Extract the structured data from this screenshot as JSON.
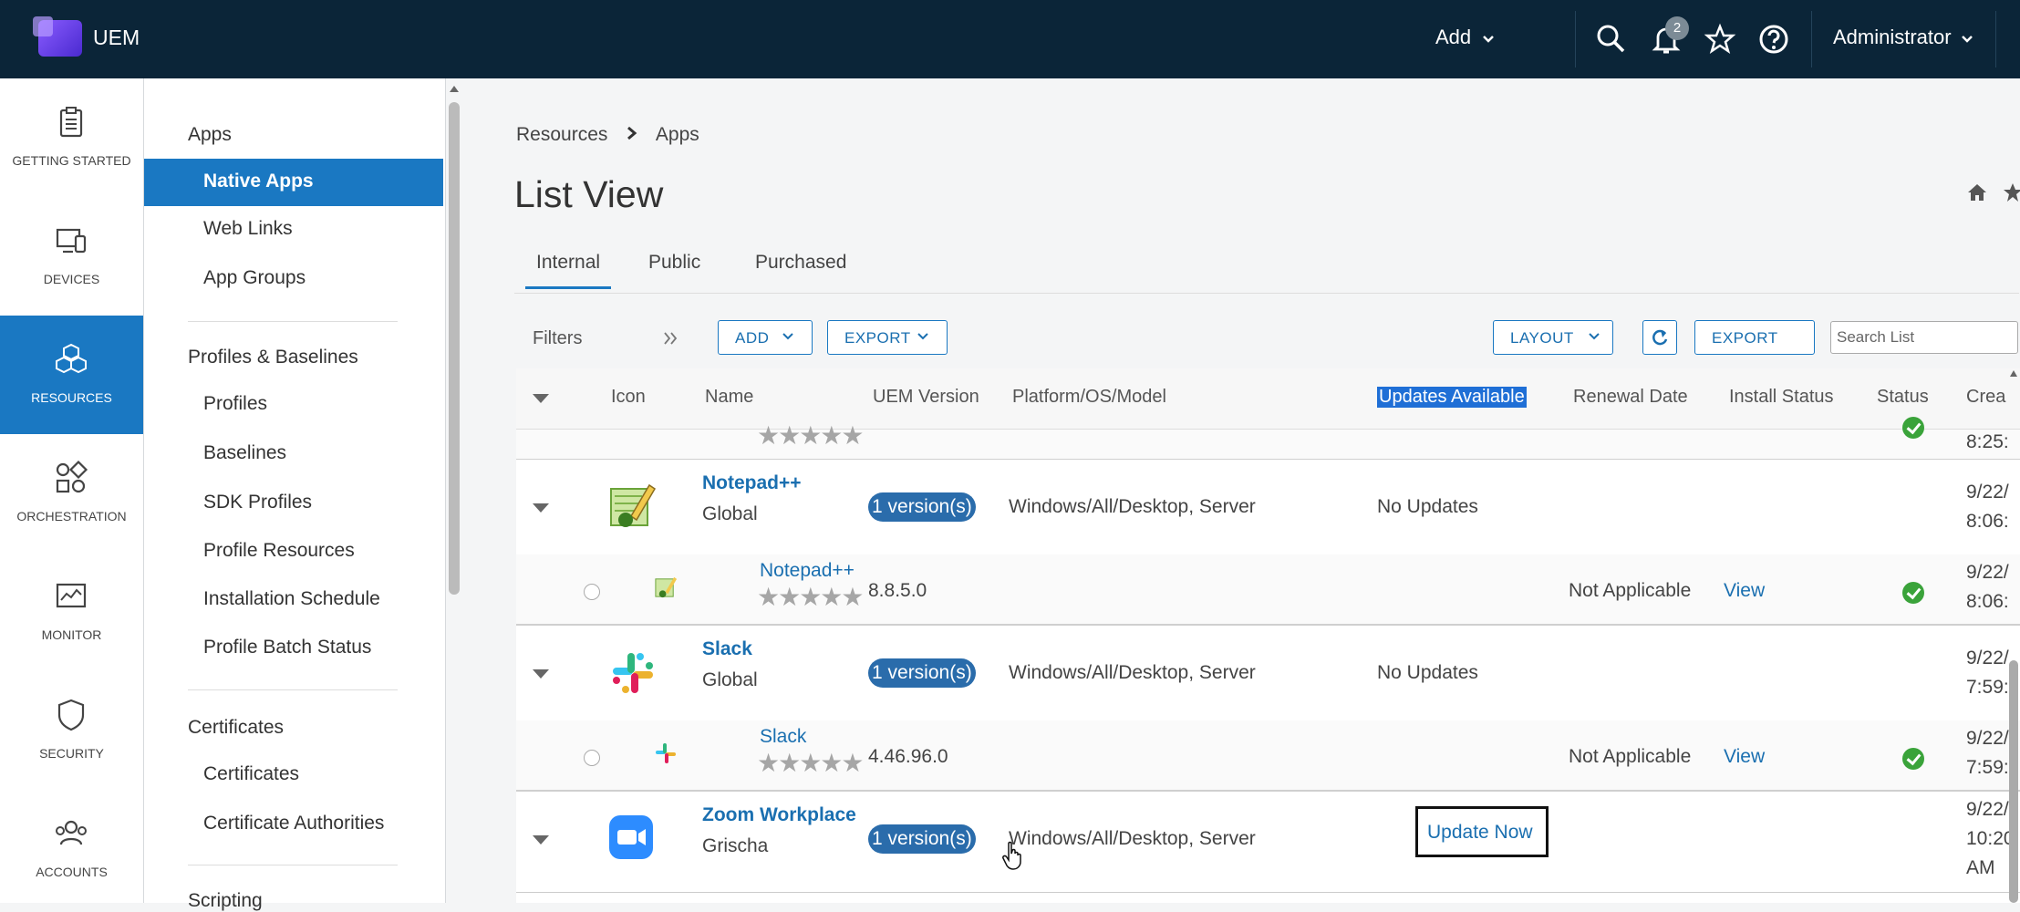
{
  "header": {
    "app_name": "UEM",
    "add_label": "Add",
    "notification_count": "2",
    "user_label": "Administrator"
  },
  "left_nav": [
    {
      "label": "GETTING STARTED",
      "icon": "clipboard-icon"
    },
    {
      "label": "DEVICES",
      "icon": "devices-icon"
    },
    {
      "label": "RESOURCES",
      "icon": "cubes-icon",
      "active": true
    },
    {
      "label": "ORCHESTRATION",
      "icon": "orchestration-icon"
    },
    {
      "label": "MONITOR",
      "icon": "monitor-icon"
    },
    {
      "label": "SECURITY",
      "icon": "shield-icon"
    },
    {
      "label": "ACCOUNTS",
      "icon": "accounts-icon"
    }
  ],
  "sub_nav": {
    "sections": [
      {
        "title": "Apps",
        "items": [
          "Native Apps",
          "Web Links",
          "App Groups"
        ]
      },
      {
        "title": "Profiles & Baselines",
        "items": [
          "Profiles",
          "Baselines",
          "SDK Profiles",
          "Profile Resources",
          "Installation Schedule",
          "Profile Batch Status"
        ]
      },
      {
        "title": "Certificates",
        "items": [
          "Certificates",
          "Certificate Authorities"
        ]
      },
      {
        "title": "Scripting",
        "items": []
      }
    ],
    "active_item": "Native Apps"
  },
  "breadcrumb": {
    "root": "Resources",
    "current": "Apps"
  },
  "page_title": "List View",
  "tabs": [
    {
      "label": "Internal",
      "active": true
    },
    {
      "label": "Public"
    },
    {
      "label": "Purchased"
    }
  ],
  "toolbar": {
    "filters_label": "Filters",
    "add_label": "ADD",
    "export_label": "EXPORT",
    "layout_label": "LAYOUT",
    "export2_label": "EXPORT",
    "search_placeholder": "Search List"
  },
  "columns": [
    "Icon",
    "Name",
    "UEM Version",
    "Platform/OS/Model",
    "Updates Available",
    "Renewal Date",
    "Install Status",
    "Status",
    "Crea"
  ],
  "highlighted_column": "Updates Available",
  "partial_row": {
    "created": "8:25:"
  },
  "rows": [
    {
      "app": {
        "name": "Notepad++",
        "org": "Global",
        "versions": "1 version(s)",
        "platform": "Windows/All/Desktop, Server",
        "updates": "No Updates",
        "created_date": "9/22/",
        "created_time": "8:06:"
      },
      "version": {
        "name": "Notepad++",
        "version": "8.8.5.0",
        "install_status": "Not Applicable",
        "view": "View",
        "created_date": "9/22/",
        "created_time": "8:06:"
      }
    },
    {
      "app": {
        "name": "Slack",
        "org": "Global",
        "versions": "1 version(s)",
        "platform": "Windows/All/Desktop, Server",
        "updates": "No Updates",
        "created_date": "9/22/",
        "created_time": "7:59:"
      },
      "version": {
        "name": "Slack",
        "version": "4.46.96.0",
        "install_status": "Not Applicable",
        "view": "View",
        "created_date": "9/22/",
        "created_time": "7:59:"
      }
    },
    {
      "app": {
        "name": "Zoom Workplace",
        "org": "Grischa",
        "versions": "1 version(s)",
        "platform": "Windows/All/Desktop, Server",
        "updates": "Update Now",
        "created_date": "9/22/",
        "created_time": "10:20",
        "created_ampm": "AM"
      }
    }
  ]
}
